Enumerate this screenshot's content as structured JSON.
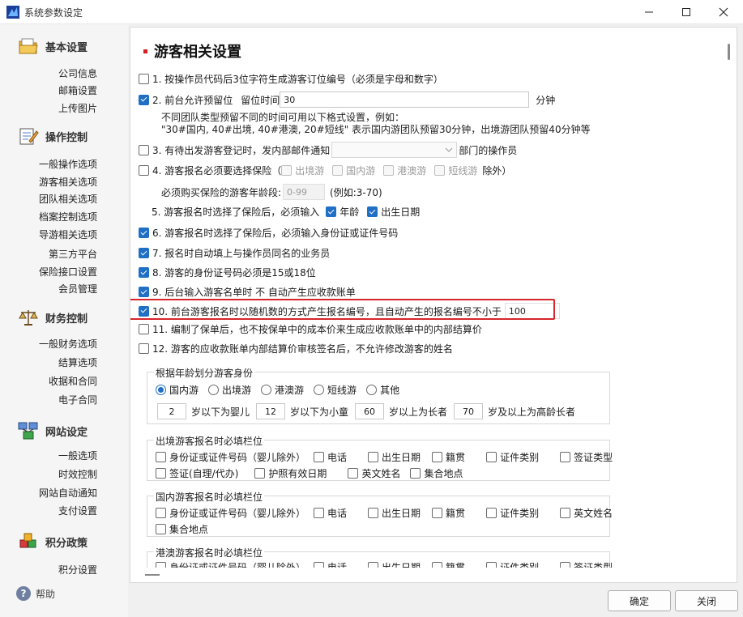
{
  "window": {
    "title": "系统参数设定"
  },
  "sidebar": {
    "groups": [
      {
        "title": "基本设置",
        "icon": "folder-icon",
        "items": [
          "公司信息",
          "邮箱设置",
          "上传图片"
        ]
      },
      {
        "title": "操作控制",
        "icon": "notepad-icon",
        "items": [
          "一般操作选项",
          "游客相关选项",
          "团队相关选项",
          "档案控制选项",
          "导游相关选项",
          "第三方平台",
          "保险接口设置",
          "会员管理"
        ]
      },
      {
        "title": "财务控制",
        "icon": "scale-icon",
        "items": [
          "一般财务选项",
          "结算选项",
          "收据和合同",
          "电子合同"
        ]
      },
      {
        "title": "网站设定",
        "icon": "network-icon",
        "items": [
          "一般选项",
          "时效控制",
          "网站自动通知",
          "支付设置"
        ]
      },
      {
        "title": "积分政策",
        "icon": "cubes-icon",
        "items": [
          "积分设置"
        ]
      }
    ],
    "help": "帮助"
  },
  "section": {
    "title": "游客相关设置",
    "opt1": {
      "checked": false,
      "label": "1. 按操作员代码后3位字符生成游客订位编号（必须是字母和数字）"
    },
    "opt2": {
      "checked": true,
      "label": "2. 前台允许预留位",
      "field_label": "留位时间",
      "value": "30",
      "unit": "分钟",
      "note1": "不同团队类型预留不同的时间可用以下格式设置，例如：",
      "note2": "\"30#国内, 40#出境, 40#港澳, 20#短线\" 表示国内游团队预留30分钟，出境游团队预留40分钟等"
    },
    "opt3": {
      "checked": false,
      "label": "3. 有待出发游客登记时，发内部邮件通知",
      "suffix": "部门的操作员"
    },
    "opt4": {
      "checked": false,
      "label": "4. 游客报名必须要选择保险（",
      "types": [
        "出境游",
        "国内游",
        "港澳游",
        "短线游"
      ],
      "suffix": "除外）",
      "age_label": "必须购买保险的游客年龄段:",
      "age_value": "0-99",
      "age_hint": "(例如:3-70)"
    },
    "opt5": {
      "label": "5. 游客报名时选择了保险后，必须输入",
      "age": "年龄",
      "birth": "出生日期"
    },
    "opt6": {
      "checked": true,
      "label": "6. 游客报名时选择了保险后，必须输入身份证或证件号码"
    },
    "opt7": {
      "checked": true,
      "label": "7. 报名时自动填上与操作员同名的业务员"
    },
    "opt8": {
      "checked": true,
      "label": "8. 游客的身份证号码必须是15或18位"
    },
    "opt9": {
      "checked": true,
      "label": "9. 后台输入游客名单时 不 自动产生应收款账单"
    },
    "opt10": {
      "checked": true,
      "label": "10. 前台游客报名时以随机数的方式产生报名编号，且自动产生的报名编号不小于",
      "value": "100"
    },
    "opt11": {
      "checked": false,
      "label": "11. 编制了保单后，也不按保单中的成本价来生成应收款账单中的内部结算价"
    },
    "opt12": {
      "checked": false,
      "label": "12. 游客的应收款账单内部结算价审核签名后，不允许修改游客的姓名"
    }
  },
  "age_group": {
    "title": "根据年龄划分游客身份",
    "radios": [
      "国内游",
      "出境游",
      "港澳游",
      "短线游",
      "其他"
    ],
    "selected": "国内游",
    "infant_age": "2",
    "infant_label": "岁以下为婴儿",
    "child_age": "12",
    "child_label": "岁以下为小童",
    "elder_age": "60",
    "elder_label": "岁以上为长者",
    "senior_age": "70",
    "senior_label": "岁及以上为高龄长者"
  },
  "outbound_group": {
    "title": "出境游客报名时必填栏位",
    "row1": [
      "身份证或证件号码（婴儿除外）",
      "电话",
      "出生日期",
      "籍贯",
      "证件类别",
      "签证类型"
    ],
    "row2": [
      "签证(自理/代办)",
      "护照有效日期",
      "英文姓名",
      "集合地点"
    ]
  },
  "domestic_group": {
    "title": "国内游客报名时必填栏位",
    "row1": [
      "身份证或证件号码（婴儿除外）",
      "电话",
      "出生日期",
      "籍贯",
      "证件类别",
      "英文姓名"
    ],
    "row2": [
      "集合地点"
    ]
  },
  "hkmo_group": {
    "title": "港澳游客报名时必填栏位",
    "row1": [
      "身份证或证件号码（婴儿除外）",
      "电话",
      "出生日期",
      "籍贯",
      "证件类别",
      "签证类型"
    ]
  },
  "buttons": {
    "ok": "确定",
    "close": "关闭"
  },
  "colors": {
    "accent": "#1f6fc5",
    "highlight": "#d8252b",
    "title_mark": "#d02020"
  }
}
